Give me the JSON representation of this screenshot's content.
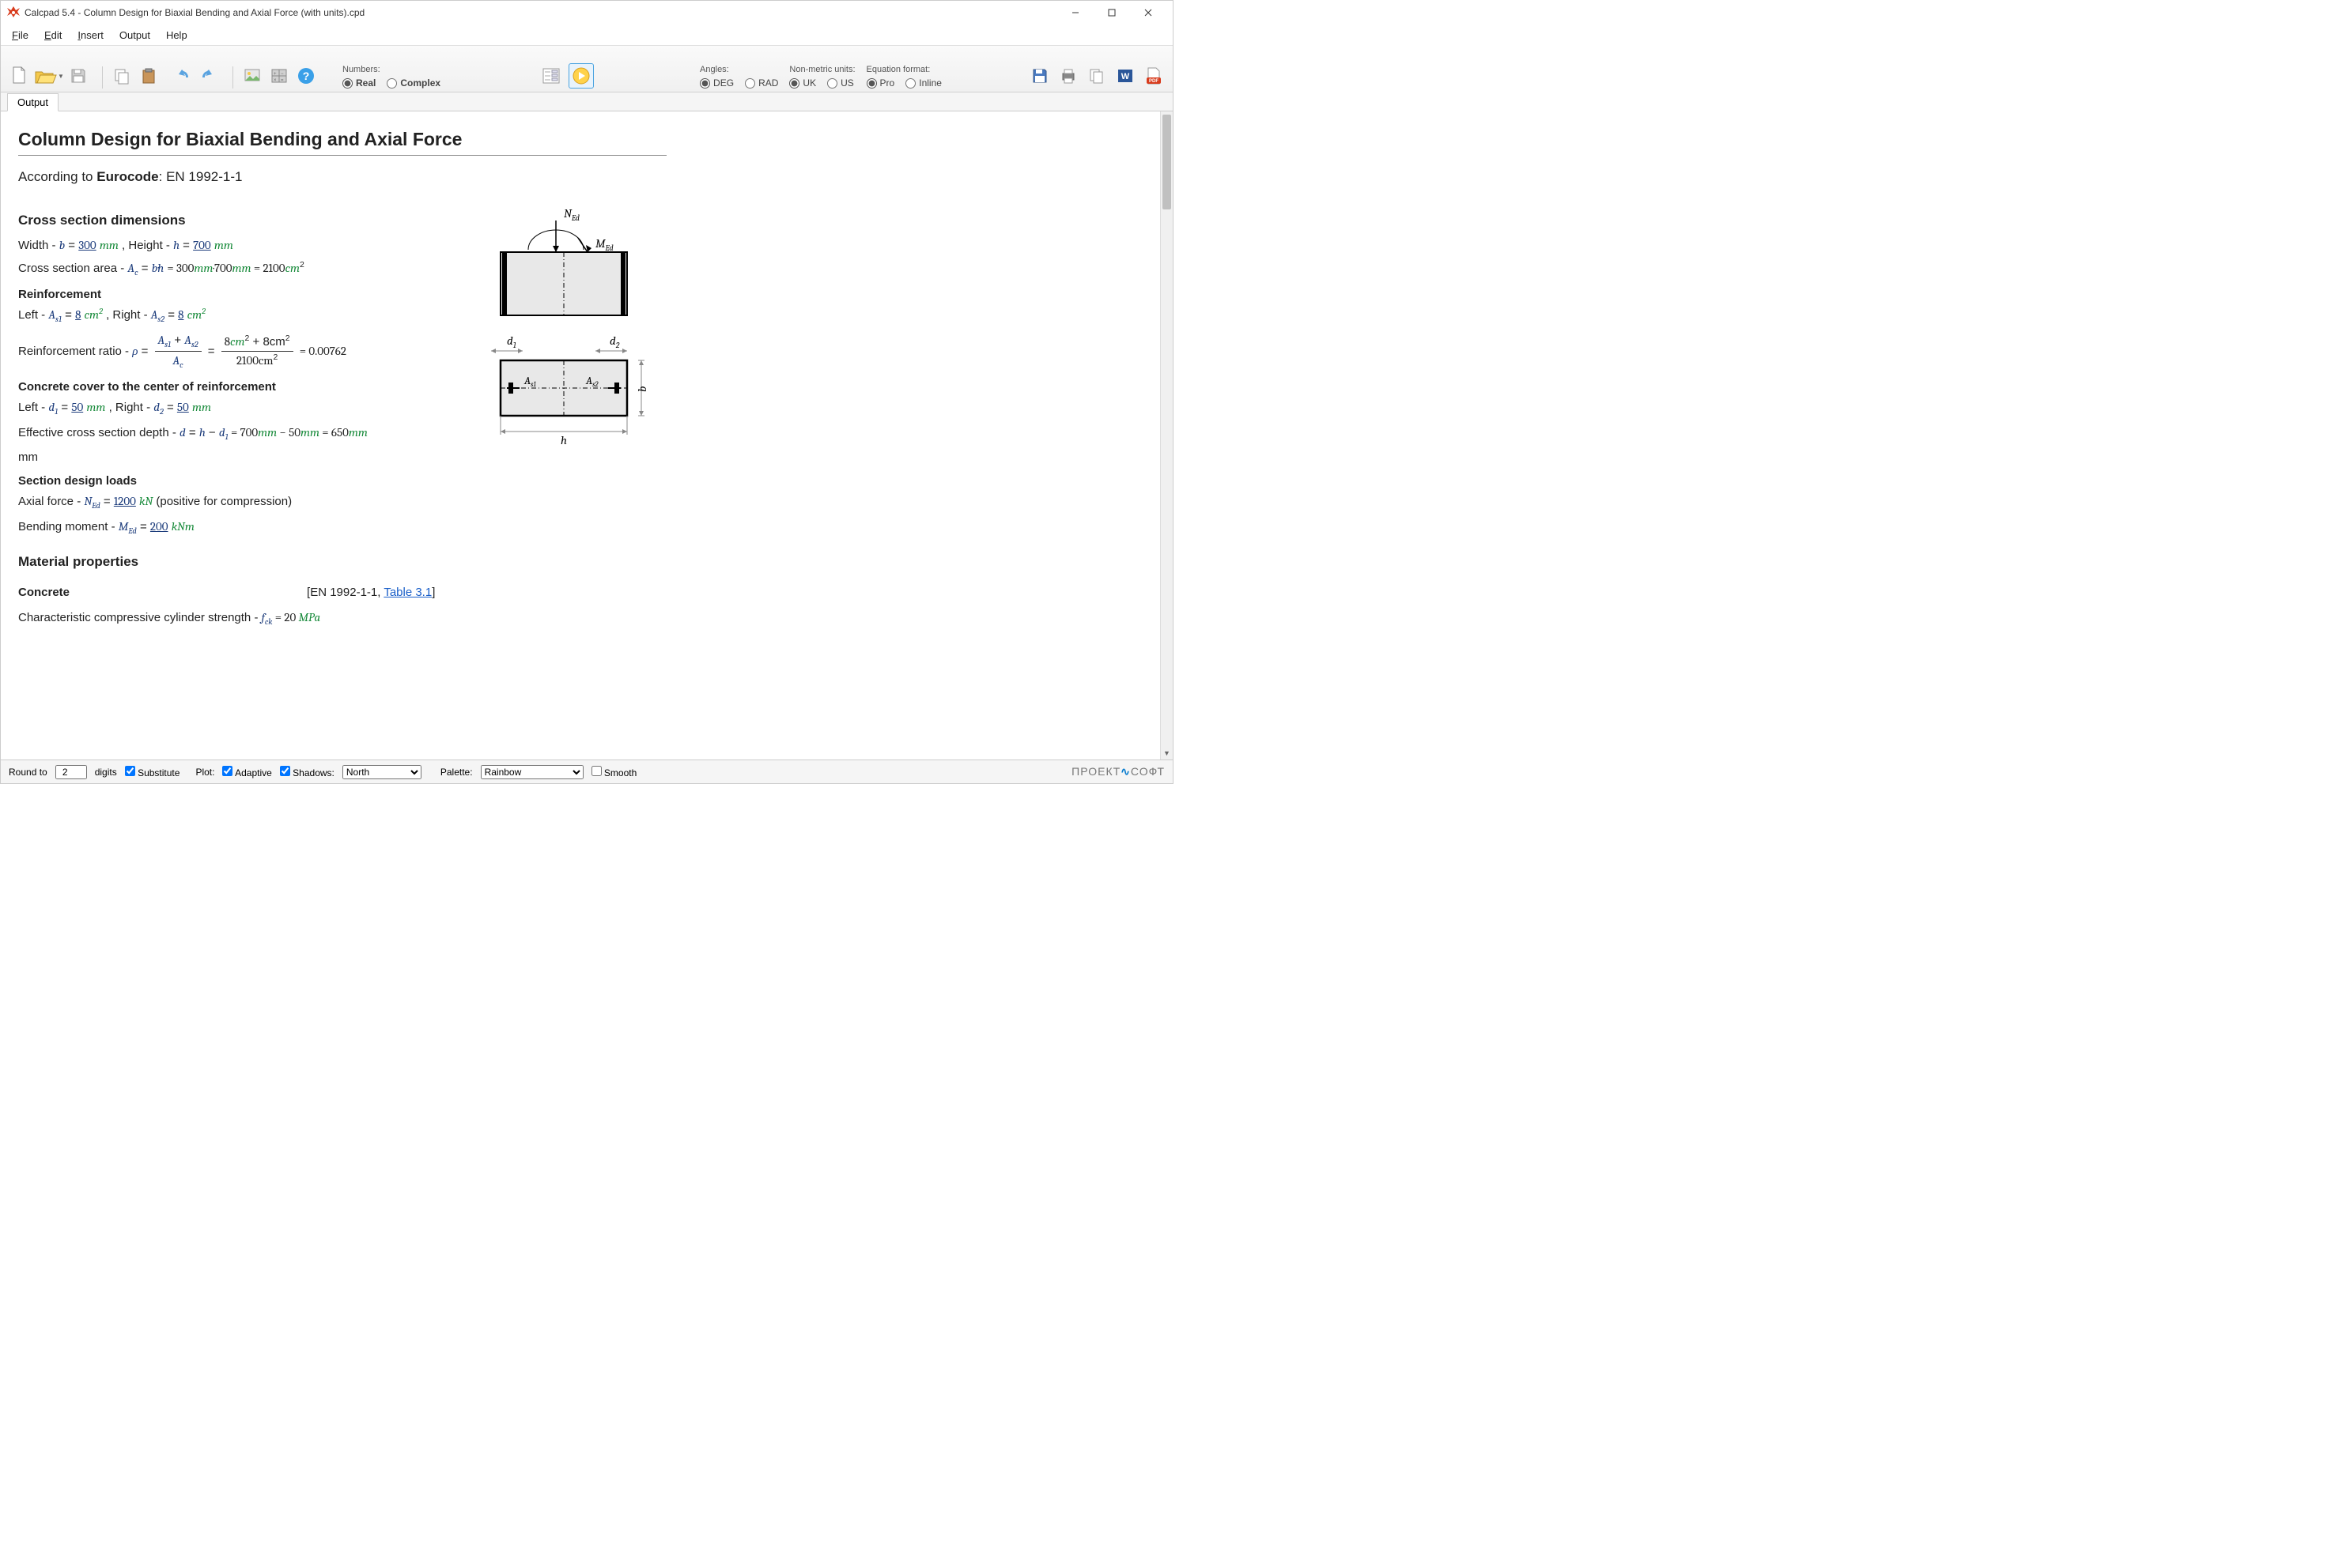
{
  "window": {
    "title": "Calcpad 5.4 - Column Design for Biaxial Bending and Axial Force (with units).cpd"
  },
  "menu": {
    "file": "File",
    "edit": "Edit",
    "insert": "Insert",
    "output": "Output",
    "help": "Help"
  },
  "toolbar": {
    "numbers_label": "Numbers:",
    "real": "Real",
    "complex": "Complex",
    "angles_label": "Angles:",
    "deg": "DEG",
    "rad": "RAD",
    "nonmetric_label": "Non-metric units:",
    "uk": "UK",
    "us": "US",
    "eqfmt_label": "Equation format:",
    "pro": "Pro",
    "inline": "Inline"
  },
  "tab": {
    "output": "Output"
  },
  "doc": {
    "h1": "Column Design for Biaxial Bending and Axial Force",
    "according_pre": "According to ",
    "eurocode": "Eurocode",
    "according_post": ": EN 1992-1-1",
    "s1": "Cross section dimensions",
    "width_label": "Width - ",
    "b": "b",
    "b_val": "300",
    "b_unit": "mm",
    "height_sep": " , Height - ",
    "h": "h",
    "h_val": "700",
    "h_unit": "mm",
    "area_label": "Cross section area - ",
    "Ac": "A",
    "Ac_sub": "c",
    "area_eq": " = ",
    "area_expr_1": "b·h",
    " area_expr_res": " = 300",
    "area_u1": "mm",
    "area_mid": "·700",
    "area_u2": "mm",
    "area_eq2": " = 2100",
    "area_u3": "cm",
    "area_sup": "2",
    "s2": "Reinforcement",
    "left_label": "Left - ",
    "As1": "A",
    "As1_sub": "s1",
    "as1_val": "8",
    "as1_unit": "cm",
    "sup2": "2",
    "right_sep": " , Right - ",
    "As2": "A",
    "As2_sub": "s2",
    "as2_val": "8",
    "as2_unit": "cm",
    "ratio_label": "Reinforcement ratio - ",
    "rho": "ρ",
    "ratio_num": "A",
    "ratio_num_s1": "s1",
    "ratio_plus": " + ",
    "ratio_num2": "A",
    "ratio_num_s2": "s2",
    "ratio_den": "A",
    "ratio_den_sub": "c",
    "ratio_mid_num": "8cm",
    "ratio_mid_plus": " + 8cm",
    "ratio_mid_den": "2100cm",
    "ratio_result": " = 0.00762",
    "s3": "Concrete cover to the center of reinforcement",
    "d1": "d",
    "d1_sub": "1",
    "d1_val": "50",
    "d1_unit": "mm",
    "d2": "d",
    "d2_sub": "2",
    "d2_val": "50",
    "d2_unit": "mm",
    "eff_label": "Effective cross section depth - ",
    "d": "d",
    "eff_expr": " = ",
    "eff_h": "h",
    "eff_minus": " − ",
    "eff_d1": "d",
    "eff_d1_sub": "1",
    "eff_res": " = 700",
    "eff_u1": "mm",
    "eff_minus2": " − 50",
    "eff_u2": "mm",
    "eff_eq": " = 650",
    "eff_u3": "mm",
    "mm_line": "mm",
    "s4": "Section design loads",
    "axial_label": "Axial force - ",
    "NEd": "N",
    "NEd_sub": "Ed",
    "ned_val": "1200",
    "ned_unit": "kN",
    "axial_note": " (positive for compression)",
    "moment_label": "Bending moment - ",
    "MEd": "M",
    "MEd_sub": "Ed",
    "med_val": "200",
    "med_unit": "kNm",
    "s5": "Material properties",
    "concrete_h": "Concrete",
    "en_ref_pre": "[EN 1992-1-1, ",
    "en_ref_link": "Table 3.1",
    "en_ref_post": "]",
    "fck_label": "Characteristic compressive cylinder strength - ",
    "fck": "f",
    "fck_sub": "ck",
    "fck_val": " = 20 ",
    "fck_unit": "MPa",
    "diag": {
      "NEd": "N",
      "NEd_sub": "Ed",
      "MEd": "M",
      "MEd_sub": "Ed",
      "d1": "d",
      "d1s": "1",
      "d2": "d",
      "d2s": "2",
      "As1": "A",
      "As1s": "s1",
      "As2": "A",
      "As2s": "s2",
      "h": "h",
      "b": "b"
    }
  },
  "status": {
    "round_to": "Round to",
    "digits_val": "2",
    "digits": "digits",
    "substitute": "Substitute",
    "plot": "Plot:",
    "adaptive": "Adaptive",
    "shadows": "Shadows:",
    "shadows_sel": "North",
    "palette": "Palette:",
    "palette_sel": "Rainbow",
    "smooth": "Smooth",
    "company": "ПРОЕКТ",
    "company2": "СОФТ"
  }
}
